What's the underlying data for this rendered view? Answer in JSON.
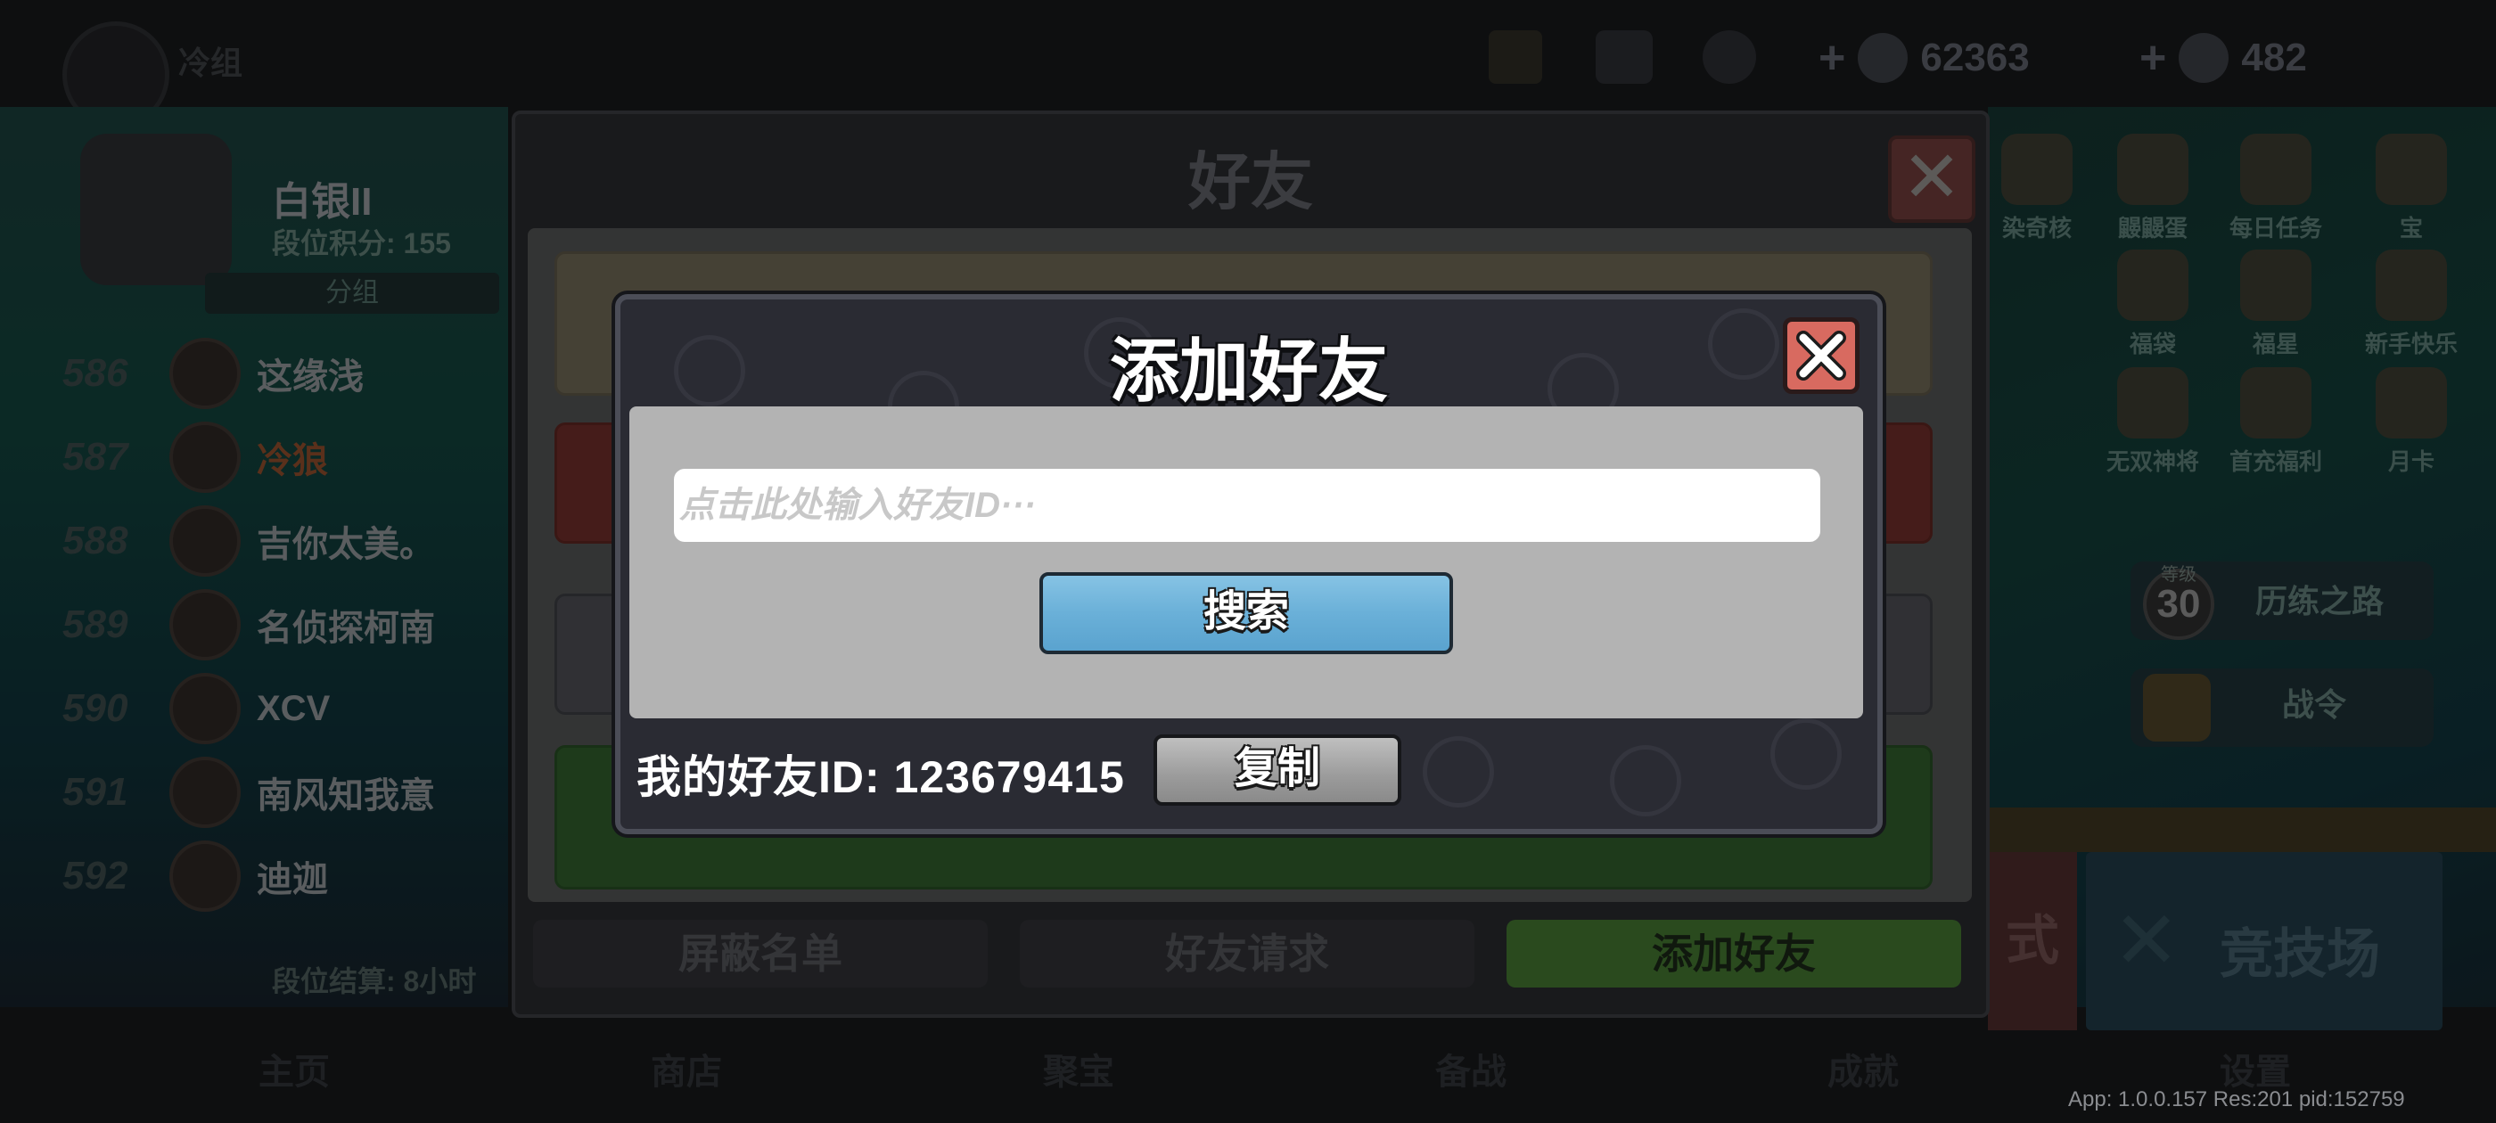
{
  "top_bar": {
    "player_name": "冷组",
    "gems": "62363",
    "energy": "482"
  },
  "rank_panel": {
    "tier": "白银II",
    "points_label": "段位积分: 155",
    "group_label": "分组",
    "rows": [
      {
        "rank": "586",
        "name": "这缘浅"
      },
      {
        "rank": "587",
        "name": "冷狼"
      },
      {
        "rank": "588",
        "name": "吉你太美。"
      },
      {
        "rank": "589",
        "name": "名侦探柯南"
      },
      {
        "rank": "590",
        "name": "XCV"
      },
      {
        "rank": "591",
        "name": "南风知我意"
      },
      {
        "rank": "592",
        "name": "迪迦"
      }
    ],
    "settle_label": "段位结算: 8小时"
  },
  "right_panel": {
    "icons": [
      "染奇核",
      "鼹鼹蛋",
      "每日任务",
      "宝",
      "福袋",
      "福星",
      "新手快乐",
      "无双神将",
      "首充福利",
      "月卡"
    ],
    "level_label": "等级",
    "level_value": "30",
    "road_label": "历练之路",
    "battle_pass_label": "战令",
    "mode_label": "式",
    "arena_label": "竞技场"
  },
  "bottom_nav": [
    "主页",
    "商店",
    "聚宝",
    "备战",
    "成就",
    "设置"
  ],
  "friends_panel": {
    "title": "好友",
    "tabs": {
      "blocked": "屏蔽名单",
      "requests": "好友请求",
      "add": "添加好友"
    }
  },
  "dialog": {
    "title": "添加好友",
    "input_placeholder": "点击此处输入好友ID···",
    "input_value": "",
    "search_label": "搜索",
    "my_id_label": "我的好友ID: 123679415",
    "copy_label": "复制"
  },
  "footer": {
    "version": "App: 1.0.0.157 Res:201 pid:152759"
  },
  "colors": {
    "search_button": "#6ab0d8",
    "close_button": "#d86a60",
    "add_tab_active": "#4e9a3a"
  }
}
